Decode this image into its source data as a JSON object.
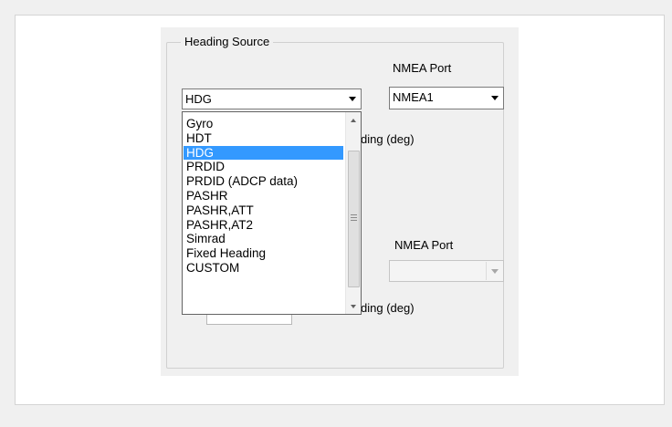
{
  "group": {
    "title": "Heading Source"
  },
  "top": {
    "nmea_port_label": "NMEA Port",
    "source_combo_value": "HDG",
    "port_combo_value": "NMEA1",
    "heading_label_partial": "ding (deg)"
  },
  "bottom": {
    "nmea_port_label": "NMEA Port",
    "port_combo_value": "",
    "heading_label_partial": "ding (deg)"
  },
  "dropdown": {
    "selected": "HDG",
    "options": [
      "Gyro",
      "HDT",
      "HDG",
      "PRDID",
      "PRDID (ADCP data)",
      "PASHR",
      "PASHR,ATT",
      "PASHR,AT2",
      "Simrad",
      "Fixed Heading",
      "CUSTOM"
    ]
  },
  "colors": {
    "selection": "#3399ff",
    "panel": "#f0f0f0"
  },
  "icons": {
    "combo_arrow": "chevron-down-icon",
    "scroll_up": "scroll-up-arrow-icon",
    "scroll_down": "scroll-down-arrow-icon"
  }
}
